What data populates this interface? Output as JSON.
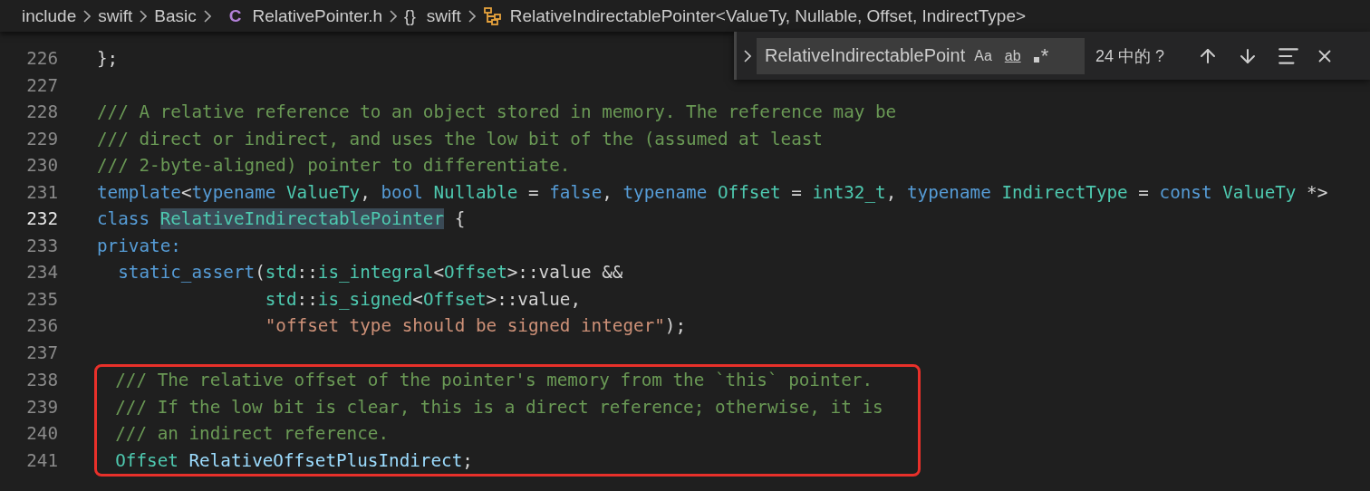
{
  "breadcrumb": [
    {
      "kind": "folder",
      "label": "include"
    },
    {
      "kind": "folder",
      "label": "swift"
    },
    {
      "kind": "folder",
      "label": "Basic"
    },
    {
      "kind": "file",
      "icon": "C",
      "label": "RelativePointer.h"
    },
    {
      "kind": "namespace",
      "icon": "{}",
      "label": "swift"
    },
    {
      "kind": "class",
      "label": "RelativeIndirectablePointer<ValueTy, Nullable, Offset, IndirectType>"
    }
  ],
  "find_widget": {
    "expanded": false,
    "query": "RelativeIndirectablePoint",
    "options": [
      {
        "kind": "case",
        "label": "Aa",
        "on": false
      },
      {
        "kind": "word",
        "label": "ab",
        "on": false
      },
      {
        "kind": "regex",
        "label": "*",
        "on": false
      }
    ],
    "result": "24 中的 ?"
  },
  "editor": {
    "lines": [
      {
        "number": "226",
        "current": false,
        "boxed": false,
        "tokens": [
          {
            "text": "};",
            "kind": "plain"
          }
        ]
      },
      {
        "number": "227",
        "current": false,
        "boxed": false
      },
      {
        "number": "228",
        "current": false,
        "boxed": false,
        "tokens": [
          {
            "text": "/// A relative reference to an object stored in memory. The reference may be",
            "kind": "comment"
          }
        ]
      },
      {
        "number": "229",
        "current": false,
        "boxed": false,
        "tokens": [
          {
            "text": "/// direct or indirect, and uses the low bit of the (assumed at least",
            "kind": "comment"
          }
        ]
      },
      {
        "number": "230",
        "current": false,
        "boxed": false,
        "tokens": [
          {
            "text": "/// 2-byte-aligned) pointer to differentiate.",
            "kind": "comment"
          }
        ]
      },
      {
        "number": "231",
        "current": false,
        "boxed": false,
        "tokens": [
          {
            "text": "template",
            "kind": "keyword"
          },
          {
            "text": "<",
            "kind": "plain"
          },
          {
            "text": "typename",
            "kind": "keyword"
          },
          {
            "text": " ValueTy",
            "kind": "type"
          },
          {
            "text": ", ",
            "kind": "plain"
          },
          {
            "text": "bool",
            "kind": "keyword"
          },
          {
            "text": " Nullable",
            "kind": "type"
          },
          {
            "text": " = ",
            "kind": "plain"
          },
          {
            "text": "false",
            "kind": "keyword"
          },
          {
            "text": ", ",
            "kind": "plain"
          },
          {
            "text": "typename",
            "kind": "keyword"
          },
          {
            "text": " Offset",
            "kind": "type"
          },
          {
            "text": " = ",
            "kind": "plain"
          },
          {
            "text": "int32_t",
            "kind": "type"
          },
          {
            "text": ", ",
            "kind": "plain"
          },
          {
            "text": "typename",
            "kind": "keyword"
          },
          {
            "text": " IndirectType",
            "kind": "type"
          },
          {
            "text": " = ",
            "kind": "plain"
          },
          {
            "text": "const",
            "kind": "keyword"
          },
          {
            "text": " ValueTy",
            "kind": "type"
          },
          {
            "text": " *>",
            "kind": "plain"
          }
        ]
      },
      {
        "number": "232",
        "current": true,
        "boxed": false,
        "tokens": [
          {
            "text": "class ",
            "kind": "keyword"
          },
          {
            "text": "RelativeIndirectablePointer",
            "kind": "type",
            "highlight": true
          },
          {
            "text": " {",
            "kind": "plain"
          }
        ]
      },
      {
        "number": "233",
        "current": false,
        "boxed": false,
        "tokens": [
          {
            "text": "private:",
            "kind": "keyword"
          }
        ]
      },
      {
        "number": "234",
        "current": false,
        "boxed": false,
        "tokens": [
          {
            "text": "  static_assert",
            "kind": "keyword"
          },
          {
            "text": "(",
            "kind": "plain"
          },
          {
            "text": "std",
            "kind": "type"
          },
          {
            "text": "::",
            "kind": "plain"
          },
          {
            "text": "is_integral",
            "kind": "type"
          },
          {
            "text": "<",
            "kind": "plain"
          },
          {
            "text": "Offset",
            "kind": "type"
          },
          {
            "text": ">::value &&",
            "kind": "plain"
          }
        ]
      },
      {
        "number": "235",
        "current": false,
        "boxed": false,
        "tokens": [
          {
            "text": "                std",
            "kind": "type"
          },
          {
            "text": "::",
            "kind": "plain"
          },
          {
            "text": "is_signed",
            "kind": "type"
          },
          {
            "text": "<",
            "kind": "plain"
          },
          {
            "text": "Offset",
            "kind": "type"
          },
          {
            "text": ">::value,",
            "kind": "plain"
          }
        ]
      },
      {
        "number": "236",
        "current": false,
        "boxed": false,
        "tokens": [
          {
            "text": "                \"offset type should be signed integer\"",
            "kind": "string"
          },
          {
            "text": ");",
            "kind": "plain"
          }
        ]
      },
      {
        "number": "237",
        "current": false,
        "boxed": false
      },
      {
        "number": "238",
        "current": false,
        "boxed": true,
        "tokens": [
          {
            "text": "  /// The relative offset of the pointer's memory from the `this` pointer.",
            "kind": "comment"
          }
        ]
      },
      {
        "number": "239",
        "current": false,
        "boxed": true,
        "tokens": [
          {
            "text": "  /// If the low bit is clear, this is a direct reference; otherwise, it is",
            "kind": "comment"
          }
        ]
      },
      {
        "number": "240",
        "current": false,
        "boxed": true,
        "tokens": [
          {
            "text": "  /// an indirect reference.",
            "kind": "comment"
          }
        ]
      },
      {
        "number": "241",
        "current": false,
        "boxed": true,
        "tokens": [
          {
            "text": "  Offset",
            "kind": "type"
          },
          {
            "text": " RelativeOffsetPlusIndirect",
            "kind": "variable"
          },
          {
            "text": ";",
            "kind": "plain"
          }
        ]
      }
    ]
  }
}
